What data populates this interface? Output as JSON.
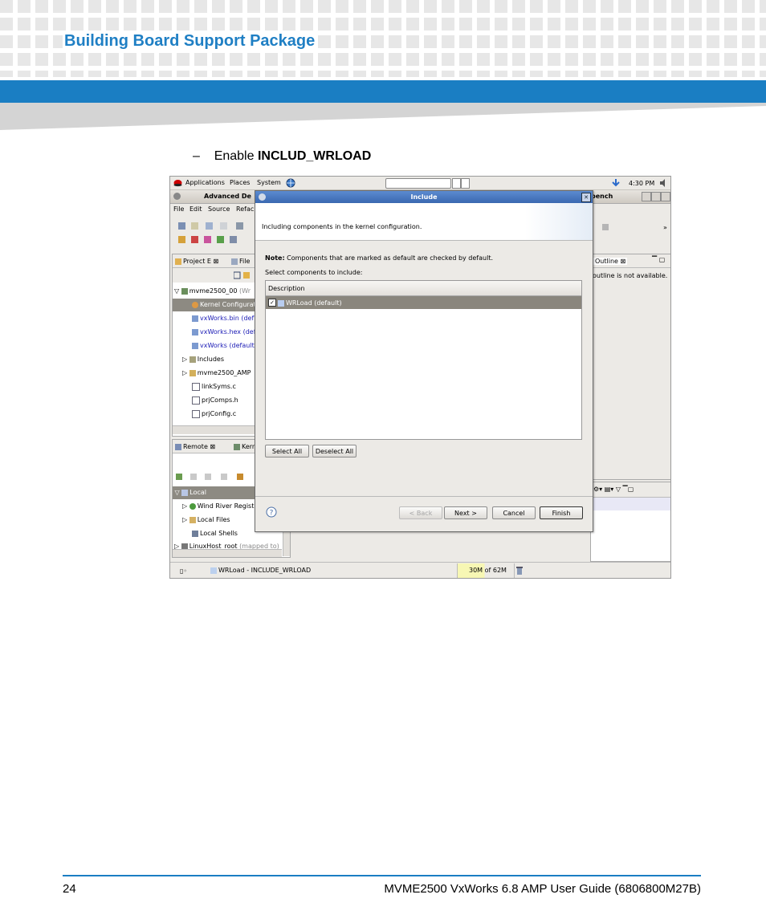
{
  "header": {
    "title": "Building Board Support Package"
  },
  "step": {
    "dash": "–",
    "text": "Enable ",
    "bold": "INCLUD_WRLOAD"
  },
  "screenshot": {
    "topbar": {
      "applications": "Applications",
      "places": "Places",
      "system": "System",
      "clock": "4:30 PM"
    },
    "ide": {
      "title_left": "Advanced De",
      "title_right": "bench",
      "menu": [
        "File",
        "Edit",
        "Source",
        "Refac"
      ],
      "project_tab": "Project E",
      "file_tab": "File",
      "outline_tab": "Outline",
      "outline_msg": "outline is not available.",
      "remote_tab": "Remote",
      "kern_tab": "Kern",
      "tree": [
        {
          "label": "mvme2500_00",
          "suffix": "(Wr"
        },
        {
          "label": "Kernel Configurat",
          "selected": true
        },
        {
          "label": "vxWorks.bin (def",
          "link": true
        },
        {
          "label": "vxWorks.hex (def",
          "link": true
        },
        {
          "label": "vxWorks (default",
          "link": true
        },
        {
          "label": "Includes"
        },
        {
          "label": "mvme2500_AMP"
        },
        {
          "label": "linkSyms.c"
        },
        {
          "label": "prjComps.h"
        },
        {
          "label": "prjConfig.c"
        }
      ],
      "remote_tree": [
        {
          "label": "Local",
          "selected": true
        },
        {
          "label": "Wind River Regist"
        },
        {
          "label": "Local Files"
        },
        {
          "label": "Local Shells"
        },
        {
          "label": "LinuxHost_root",
          "suffix": "(mapped to)"
        }
      ],
      "status": {
        "message": "WRLoad - INCLUDE_WRLOAD",
        "memory": "30M of 62M"
      }
    },
    "dialog": {
      "title": "Include",
      "heading": "Including components in the kernel configuration.",
      "note_label": "Note:",
      "note_text": " Components that are marked as default are checked by default.",
      "select_label": "Select components to include:",
      "column": "Description",
      "row": "WRLoad (default)",
      "select_all": "Select All",
      "deselect_all": "Deselect All",
      "back": "< Back",
      "next": "Next >",
      "cancel": "Cancel",
      "finish": "Finish"
    }
  },
  "footer": {
    "page": "24",
    "title": "MVME2500 VxWorks 6.8 AMP User Guide (6806800M27B)"
  }
}
